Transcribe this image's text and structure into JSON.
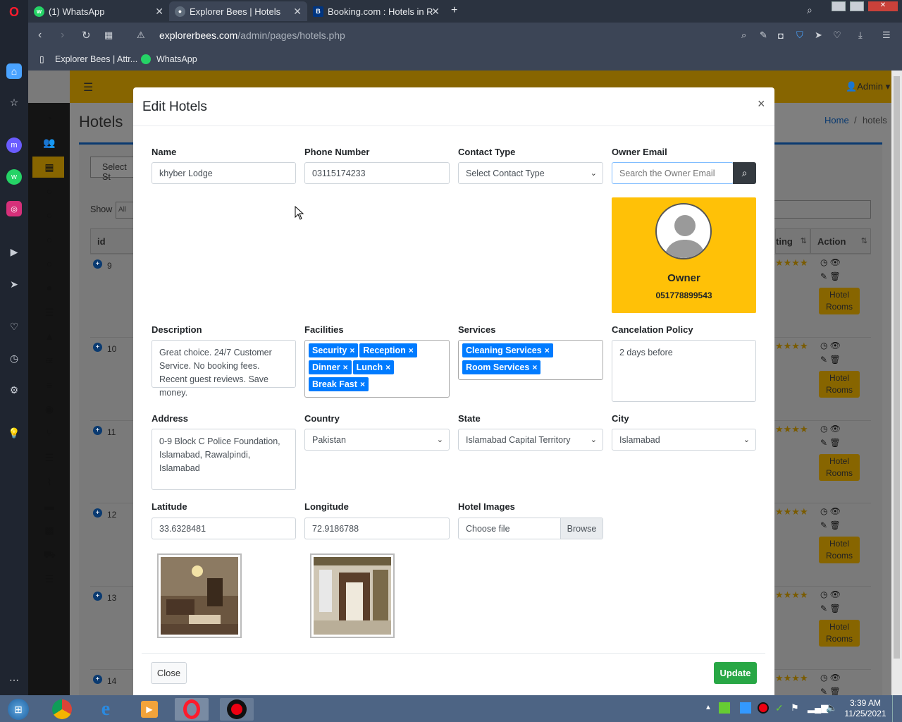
{
  "browser": {
    "tabs": [
      {
        "label": "(1) WhatsApp",
        "icon": "whatsapp-icon",
        "color": "#25d366"
      },
      {
        "label": "Explorer Bees | Hotels",
        "icon": "globe-icon",
        "color": "#5f6b7a"
      },
      {
        "label": "Booking.com : Hotels in Ra",
        "icon": "booking-icon",
        "color": "#003580"
      }
    ],
    "url_host": "explorerbees.com",
    "url_path": "/admin/pages/hotels.php",
    "bookmarks": [
      "Explorer Bees | Attr...",
      "WhatsApp"
    ]
  },
  "app": {
    "header_user": "Admin",
    "page_title": "Hotels",
    "breadcrumb_home": "Home",
    "breadcrumb_current": "hotels",
    "select_placeholder": "Select St",
    "show_label": "Show",
    "show_value": "All",
    "table": {
      "col_id": "id",
      "col_rating": "ting",
      "col_action": "Action",
      "row_ids": [
        "9",
        "10",
        "11",
        "12",
        "13",
        "14"
      ],
      "rooms_button": "Hotel Rooms"
    }
  },
  "modal": {
    "title": "Edit Hotels",
    "close_x": "×",
    "name_label": "Name",
    "name_value": "khyber Lodge",
    "phone_label": "Phone Number",
    "phone_value": "03115174233",
    "contact_label": "Contact Type",
    "contact_value": "Select Contact Type",
    "owner_email_label": "Owner Email",
    "owner_email_placeholder": "Search the Owner Email",
    "owner_card": {
      "title": "Owner",
      "phone": "051778899543",
      "bg": "#ffc107"
    },
    "description_label": "Description",
    "description_value": "Great choice. 24/7 Customer Service. No booking fees. Recent guest reviews. Save money.",
    "facilities_label": "Facilities",
    "facilities": [
      "Security",
      "Reception",
      "Dinner",
      "Lunch",
      "Break Fast"
    ],
    "services_label": "Services",
    "services": [
      "Cleaning Services",
      "Room Services"
    ],
    "cancel_label": "Cancelation Policy",
    "cancel_value": "2 days before",
    "address_label": "Address",
    "address_value": "0-9 Block C Police Foundation, Islamabad, Rawalpindi, Islamabad",
    "country_label": "Country",
    "country_value": "Pakistan",
    "state_label": "State",
    "state_value": "Islamabad Capital Territory",
    "city_label": "City",
    "city_value": "Islamabad",
    "lat_label": "Latitude",
    "lat_value": "33.6328481",
    "lng_label": "Longitude",
    "lng_value": "72.9186788",
    "images_label": "Hotel Images",
    "file_placeholder": "Choose file",
    "browse_label": "Browse",
    "close_button": "Close",
    "update_button": "Update",
    "update_color": "#28a745",
    "tag_color": "#007bff"
  },
  "taskbar": {
    "time": "3:39 AM",
    "date": "11/25/2021"
  }
}
